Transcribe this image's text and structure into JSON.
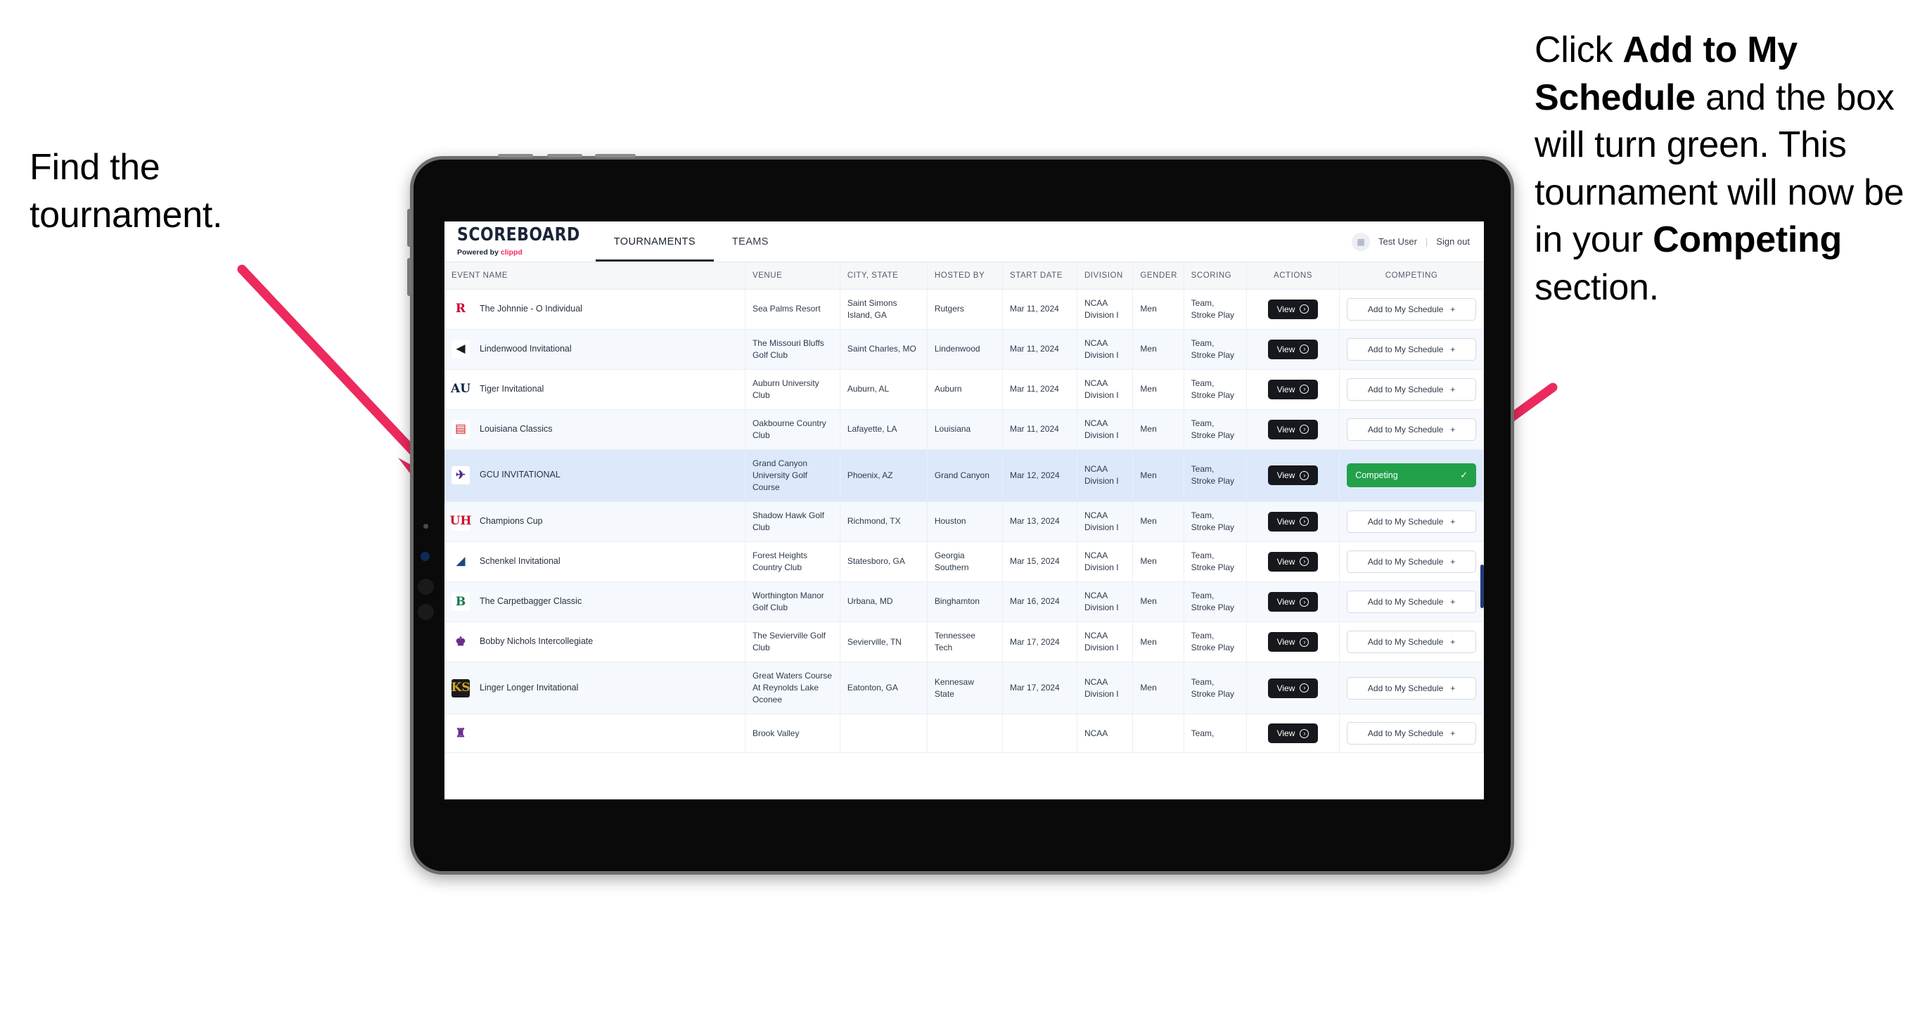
{
  "annotations": {
    "left": {
      "line1": "Find the",
      "line2": "tournament."
    },
    "right": {
      "p1_a": "Click ",
      "p1_b": "Add to My Schedule",
      "p1_c": " and the box will turn green. ",
      "p2_a": "This tournament will now be in your ",
      "p2_b": "Competing",
      "p2_c": " section."
    },
    "arrow_color": "#ec2a5e"
  },
  "app": {
    "brand": {
      "name": "SCOREBOARD",
      "tagline_pre": "Powered by ",
      "tagline_brand": "clippd"
    },
    "nav": [
      {
        "label": "TOURNAMENTS",
        "active": true
      },
      {
        "label": "TEAMS",
        "active": false
      }
    ],
    "user": {
      "avatar_icon": "user-avatar-icon",
      "name": "Test User",
      "separator": "|",
      "signout": "Sign out"
    },
    "table": {
      "columns": [
        "EVENT NAME",
        "VENUE",
        "CITY, STATE",
        "HOSTED BY",
        "START DATE",
        "DIVISION",
        "GENDER",
        "SCORING",
        "ACTIONS",
        "COMPETING"
      ],
      "view_label": "View",
      "add_label": "Add to My Schedule",
      "add_icon": "plus-icon",
      "competing_label": "Competing",
      "competing_icon": "check-icon",
      "rows": [
        {
          "logo_text": "R",
          "logo_fg": "#cc0033",
          "logo_bg": "#ffffff",
          "event": "The Johnnie - O Individual",
          "venue": "Sea Palms Resort",
          "city": "Saint Simons Island, GA",
          "hosted": "Rutgers",
          "date": "Mar 11, 2024",
          "division": "NCAA Division I",
          "gender": "Men",
          "scoring": "Team, Stroke Play",
          "competing": false
        },
        {
          "logo_text": "◀",
          "logo_fg": "#1c1c1c",
          "logo_bg": "#ffffff",
          "event": "Lindenwood Invitational",
          "venue": "The Missouri Bluffs Golf Club",
          "city": "Saint Charles, MO",
          "hosted": "Lindenwood",
          "date": "Mar 11, 2024",
          "division": "NCAA Division I",
          "gender": "Men",
          "scoring": "Team, Stroke Play",
          "competing": false
        },
        {
          "logo_text": "AU",
          "logo_fg": "#0c2340",
          "logo_bg": "#ffffff",
          "event": "Tiger Invitational",
          "venue": "Auburn University Club",
          "city": "Auburn, AL",
          "hosted": "Auburn",
          "date": "Mar 11, 2024",
          "division": "NCAA Division I",
          "gender": "Men",
          "scoring": "Team, Stroke Play",
          "competing": false
        },
        {
          "logo_text": "▤",
          "logo_fg": "#ce181e",
          "logo_bg": "#ffffff",
          "event": "Louisiana Classics",
          "venue": "Oakbourne Country Club",
          "city": "Lafayette, LA",
          "hosted": "Louisiana",
          "date": "Mar 11, 2024",
          "division": "NCAA Division I",
          "gender": "Men",
          "scoring": "Team, Stroke Play",
          "competing": false
        },
        {
          "logo_text": "✈",
          "logo_fg": "#4c2a8a",
          "logo_bg": "#ffffff",
          "event": "GCU INVITATIONAL",
          "venue": "Grand Canyon University Golf Course",
          "city": "Phoenix, AZ",
          "hosted": "Grand Canyon",
          "date": "Mar 12, 2024",
          "division": "NCAA Division I",
          "gender": "Men",
          "scoring": "Team, Stroke Play",
          "competing": true
        },
        {
          "logo_text": "UH",
          "logo_fg": "#c8102e",
          "logo_bg": "#ffffff",
          "event": "Champions Cup",
          "venue": "Shadow Hawk Golf Club",
          "city": "Richmond, TX",
          "hosted": "Houston",
          "date": "Mar 13, 2024",
          "division": "NCAA Division I",
          "gender": "Men",
          "scoring": "Team, Stroke Play",
          "competing": false
        },
        {
          "logo_text": "◢",
          "logo_fg": "#1b4a7a",
          "logo_bg": "#ffffff",
          "event": "Schenkel Invitational",
          "venue": "Forest Heights Country Club",
          "city": "Statesboro, GA",
          "hosted": "Georgia Southern",
          "date": "Mar 15, 2024",
          "division": "NCAA Division I",
          "gender": "Men",
          "scoring": "Team, Stroke Play",
          "competing": false
        },
        {
          "logo_text": "B",
          "logo_fg": "#12754c",
          "logo_bg": "#ffffff",
          "event": "The Carpetbagger Classic",
          "venue": "Worthington Manor Golf Club",
          "city": "Urbana, MD",
          "hosted": "Binghamton",
          "date": "Mar 16, 2024",
          "division": "NCAA Division I",
          "gender": "Men",
          "scoring": "Team, Stroke Play",
          "competing": false
        },
        {
          "logo_text": "♚",
          "logo_fg": "#6a2d8c",
          "logo_bg": "#ffffff",
          "event": "Bobby Nichols Intercollegiate",
          "venue": "The Sevierville Golf Club",
          "city": "Sevierville, TN",
          "hosted": "Tennessee Tech",
          "date": "Mar 17, 2024",
          "division": "NCAA Division I",
          "gender": "Men",
          "scoring": "Team, Stroke Play",
          "competing": false
        },
        {
          "logo_text": "KS",
          "logo_fg": "#d0a428",
          "logo_bg": "#1a1a1a",
          "event": "Linger Longer Invitational",
          "venue": "Great Waters Course At Reynolds Lake Oconee",
          "city": "Eatonton, GA",
          "hosted": "Kennesaw State",
          "date": "Mar 17, 2024",
          "division": "NCAA Division I",
          "gender": "Men",
          "scoring": "Team, Stroke Play",
          "competing": false
        },
        {
          "logo_text": "♜",
          "logo_fg": "#6a2d8c",
          "logo_bg": "#ffffff",
          "event": "",
          "venue": "Brook Valley",
          "city": "",
          "hosted": "",
          "date": "",
          "division": "NCAA",
          "gender": "",
          "scoring": "Team,",
          "competing": false
        }
      ]
    }
  }
}
